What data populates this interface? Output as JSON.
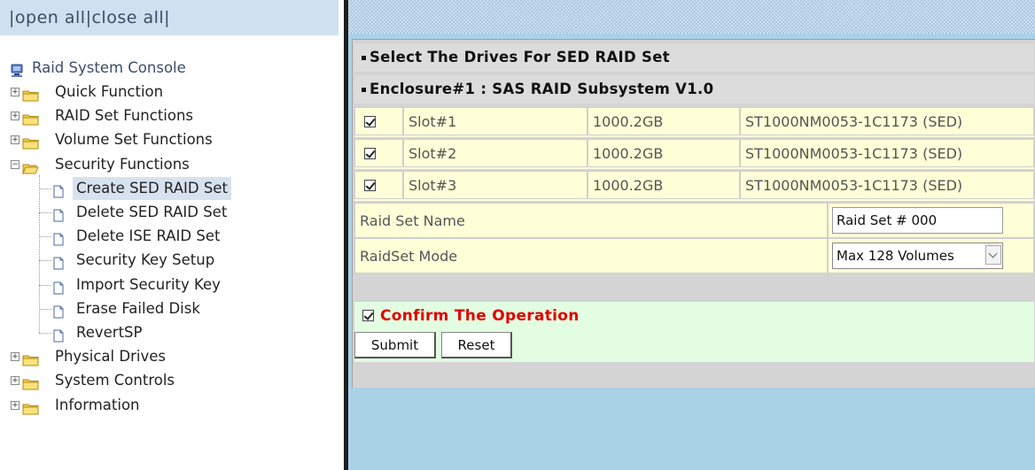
{
  "nav": {
    "open_all": "open all",
    "close_all": "close all",
    "sep1": "|",
    "sep2": "|",
    "sep3": "|",
    "root": "Raid System Console",
    "items": [
      {
        "label": "Quick Function",
        "expanded": false
      },
      {
        "label": "RAID Set Functions",
        "expanded": false
      },
      {
        "label": "Volume Set Functions",
        "expanded": false
      },
      {
        "label": "Security Functions",
        "expanded": true
      },
      {
        "label": "Physical Drives",
        "expanded": false
      },
      {
        "label": "System Controls",
        "expanded": false
      },
      {
        "label": "Information",
        "expanded": false
      }
    ],
    "security_children": [
      "Create SED RAID Set",
      "Delete SED RAID Set",
      "Delete ISE RAID Set",
      "Security Key Setup",
      "Import Security Key",
      "Erase Failed Disk",
      "RevertSP"
    ],
    "selected": "Create SED RAID Set"
  },
  "form": {
    "title": "Select The Drives For SED RAID Set",
    "enclosure": "Enclosure#1 : SAS RAID Subsystem V1.0",
    "drives": [
      {
        "checked": true,
        "slot": "Slot#1",
        "size": "1000.2GB",
        "model": "ST1000NM0053-1C1173 (SED)"
      },
      {
        "checked": true,
        "slot": "Slot#2",
        "size": "1000.2GB",
        "model": "ST1000NM0053-1C1173 (SED)"
      },
      {
        "checked": true,
        "slot": "Slot#3",
        "size": "1000.2GB",
        "model": "ST1000NM0053-1C1173 (SED)"
      }
    ],
    "raid_set_name_label": "Raid Set Name",
    "raid_set_name_value": "Raid Set # 000",
    "raidset_mode_label": "RaidSet Mode",
    "raidset_mode_value": "Max 128 Volumes",
    "confirm_label": "Confirm The Operation",
    "confirm_checked": true,
    "submit_label": "Submit",
    "reset_label": "Reset"
  },
  "colors": {
    "accent_red": "#e00000",
    "row_yellow": "#ffffd8",
    "confirm_green": "#e2fde2",
    "right_bg": "#a9d2e6"
  }
}
